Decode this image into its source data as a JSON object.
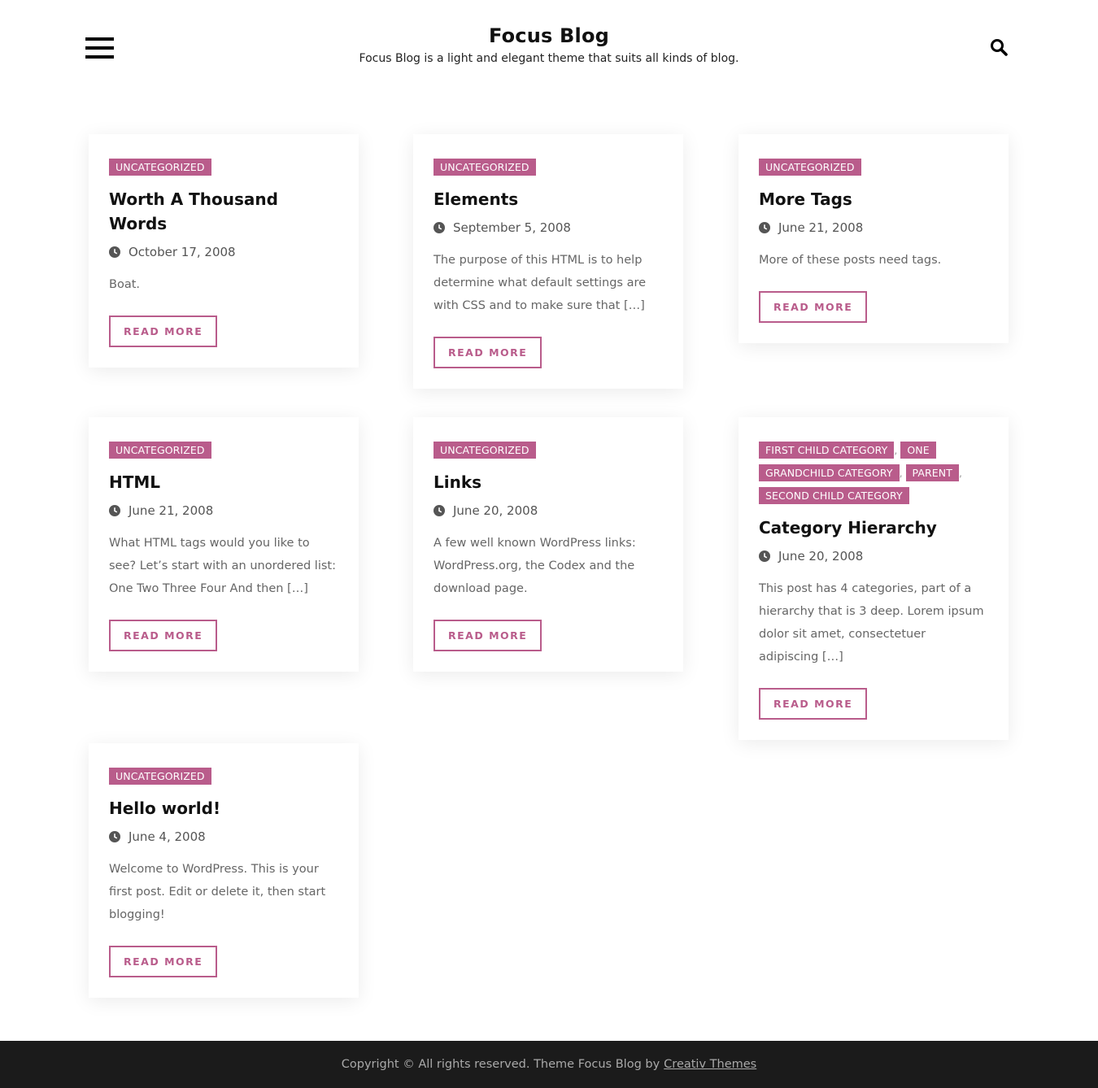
{
  "site": {
    "title": "Focus Blog",
    "description": "Focus Blog is a light and elegant theme that suits all kinds of blog."
  },
  "colors": {
    "accent": "#b95c8b",
    "footer_bg": "#1b1b1b"
  },
  "icons": {
    "menu": "hamburger-icon",
    "search": "search-icon",
    "date": "clock-icon"
  },
  "posts": [
    {
      "categories": [
        "UNCATEGORIZED"
      ],
      "title": "Worth A Thousand Words",
      "date": "October 17, 2008",
      "excerpt": "Boat.",
      "read_more": "READ MORE"
    },
    {
      "categories": [
        "UNCATEGORIZED"
      ],
      "title": "Elements",
      "date": "September 5, 2008",
      "excerpt": "The purpose of this HTML is to help determine what default settings are with CSS and to make sure that […]",
      "read_more": "READ MORE"
    },
    {
      "categories": [
        "UNCATEGORIZED"
      ],
      "title": "More Tags",
      "date": "June 21, 2008",
      "excerpt": "More of these posts need tags.",
      "read_more": "READ MORE"
    },
    {
      "categories": [
        "UNCATEGORIZED"
      ],
      "title": "HTML",
      "date": "June 21, 2008",
      "excerpt": "What HTML tags would you like to see? Let’s start with an unordered list: One Two Three Four And then […]",
      "read_more": "READ MORE"
    },
    {
      "categories": [
        "UNCATEGORIZED"
      ],
      "title": "Links",
      "date": "June 20, 2008",
      "excerpt": "A few well known WordPress links: WordPress.org, the Codex and the download page.",
      "read_more": "READ MORE"
    },
    {
      "categories": [
        "FIRST CHILD CATEGORY",
        "ONE GRANDCHILD CATEGORY",
        "PARENT",
        "SECOND CHILD CATEGORY"
      ],
      "separator": ",",
      "title": "Category Hierarchy",
      "date": "June 20, 2008",
      "excerpt": "This post has 4 categories, part of a hierarchy that is 3 deep. Lorem ipsum dolor sit amet, consectetuer adipiscing […]",
      "read_more": "READ MORE"
    },
    {
      "categories": [
        "UNCATEGORIZED"
      ],
      "title": "Hello world!",
      "date": "June 4, 2008",
      "excerpt": "Welcome to WordPress. This is your first post. Edit or delete it, then start blogging!",
      "read_more": "READ MORE"
    }
  ],
  "footer": {
    "text": "Copyright © All rights reserved. Theme Focus Blog by",
    "link": "Creativ Themes"
  }
}
